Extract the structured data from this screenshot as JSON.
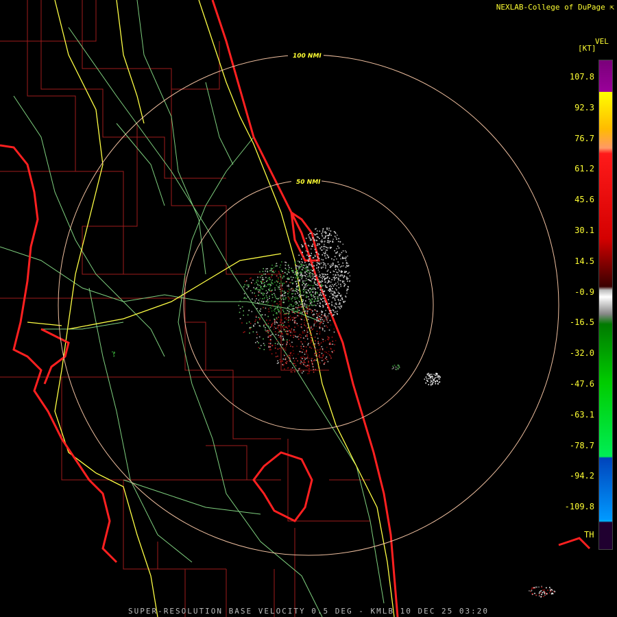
{
  "credit": "NEXLAB-College of DuPage",
  "legend": {
    "product": "VEL",
    "units": "[KT]",
    "ticks": [
      "107.8",
      "92.3",
      "76.7",
      "61.2",
      "45.6",
      "30.1",
      "14.5",
      "-0.9",
      "-16.5",
      "-32.0",
      "-47.6",
      "-63.1",
      "-78.7",
      "-94.2",
      "-109.8"
    ],
    "th_label": "TH"
  },
  "range_rings": {
    "inner": "50 NMI",
    "outer": "100 NMI"
  },
  "footer": "SUPER-RESOLUTION BASE VELOCITY 0.5 DEG - KMLB 10 DEC 25 03:20",
  "colors": {
    "background": "#000000",
    "coastline": "#ff2020",
    "county_lines": "#b02020",
    "highways": "#ffff44",
    "roads": "#7fd07f",
    "range_rings": "#f0c0a0",
    "text": "#ffff33"
  }
}
